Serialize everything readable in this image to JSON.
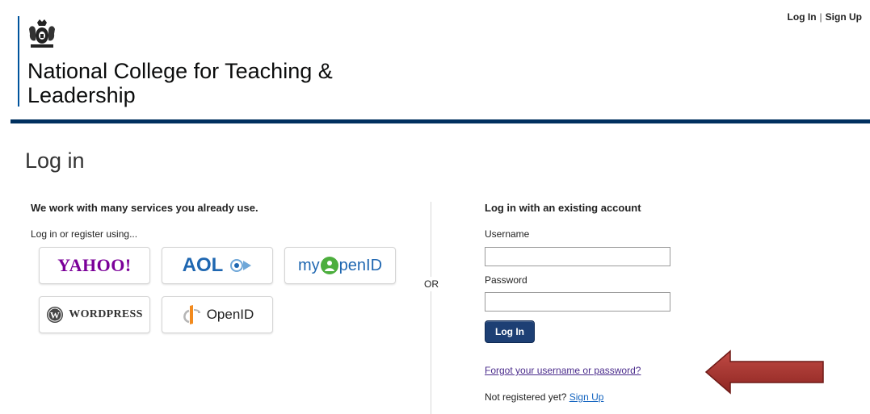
{
  "header": {
    "org_name": "National College for Teaching & Leadership",
    "login_link": "Log In",
    "separator": "|",
    "signup_link": "Sign Up"
  },
  "page_title": "Log in",
  "social": {
    "heading": "We work with many services you already use.",
    "subheading": "Log in or register using...",
    "providers": [
      {
        "name": "Yahoo",
        "label": "YAHOO!"
      },
      {
        "name": "AOL",
        "label": "AOL"
      },
      {
        "name": "myOpenID",
        "label_prefix": "my",
        "label_suffix": "penID"
      },
      {
        "name": "WordPress",
        "label": "WORDPRESS"
      },
      {
        "name": "OpenID",
        "label": "OpenID"
      }
    ]
  },
  "or_label": "OR",
  "account": {
    "heading": "Log in with an existing account",
    "username_label": "Username",
    "username_value": "",
    "password_label": "Password",
    "password_value": "",
    "login_button": "Log In",
    "forgot_link": "Forgot your username or password?",
    "not_registered_text": "Not registered yet?",
    "signup_link": "Sign Up"
  },
  "colors": {
    "brand_blue": "#00305f",
    "button_blue": "#1d3f74",
    "arrow_red": "#a8322c",
    "link_purple": "#4b2c8c"
  },
  "icons": {
    "crest": "royal-crest-icon",
    "arrow": "red-arrow-pointer"
  }
}
